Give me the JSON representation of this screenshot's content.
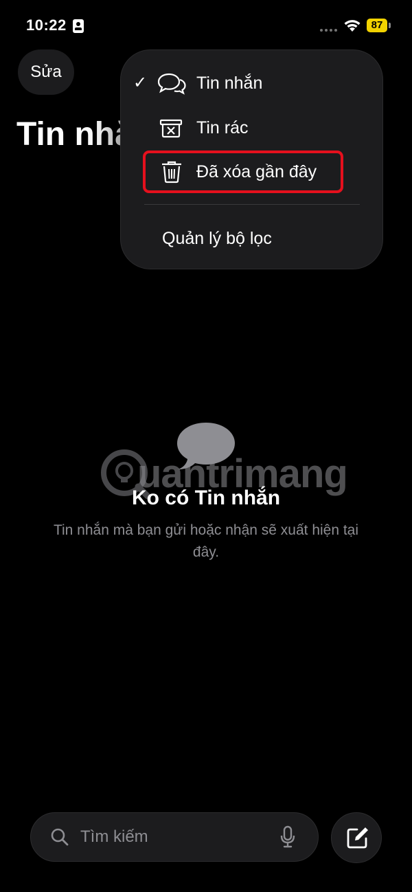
{
  "status_bar": {
    "time": "10:22",
    "battery": "87"
  },
  "header": {
    "edit_label": "Sửa",
    "title": "Tin nhắn"
  },
  "menu": {
    "items": [
      {
        "label": "Tin nhắn",
        "checked": true,
        "icon": "messages-bubbles-icon"
      },
      {
        "label": "Tin rác",
        "checked": false,
        "icon": "junk-bin-icon"
      },
      {
        "label": "Đã xóa gần đây",
        "checked": false,
        "icon": "trash-icon",
        "highlighted": true
      }
    ],
    "manage_filters": "Quản lý bộ lọc",
    "check_glyph": "✓"
  },
  "empty_state": {
    "title": "Ko có Tin nhắn",
    "description": "Tin nhắn mà bạn gửi hoặc nhận sẽ xuất hiện tại đây.",
    "icon": "message-bubble-icon"
  },
  "watermark": {
    "text": "uantrimang"
  },
  "search": {
    "placeholder": "Tìm kiếm"
  },
  "colors": {
    "highlight": "#e5101d",
    "battery": "#f5d500",
    "secondary_text": "#8e8e93"
  }
}
